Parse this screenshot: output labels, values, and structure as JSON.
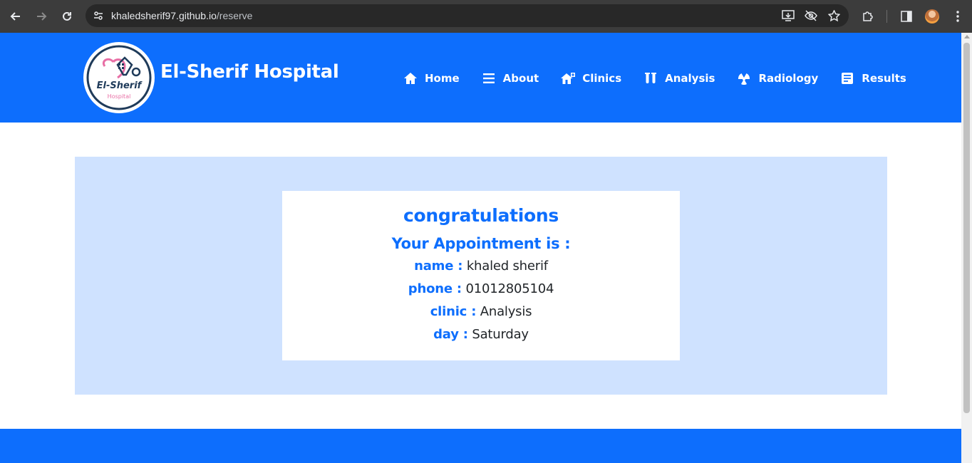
{
  "browser": {
    "url_host": "khaledsherif97.github.io",
    "url_path": "/reserve"
  },
  "header": {
    "brand": "El-Sherif Hospital",
    "logo": {
      "title": "El-Sherif",
      "subtitle": "Hospital"
    },
    "nav": [
      {
        "label": "Home",
        "icon": "home-icon"
      },
      {
        "label": "About",
        "icon": "bars-icon"
      },
      {
        "label": "Clinics",
        "icon": "clinic-icon"
      },
      {
        "label": "Analysis",
        "icon": "test-tubes-icon"
      },
      {
        "label": "Radiology",
        "icon": "radiation-icon"
      },
      {
        "label": "Results",
        "icon": "file-icon"
      }
    ]
  },
  "appointment": {
    "heading": "congratulations",
    "subheading": "Your Appointment is :",
    "fields": [
      {
        "label": "name :",
        "value": "khaled sherif"
      },
      {
        "label": "phone :",
        "value": "01012805104"
      },
      {
        "label": "clinic :",
        "value": "Analysis"
      },
      {
        "label": "day :",
        "value": "Saturday"
      }
    ]
  },
  "colors": {
    "primary": "#0d6efd",
    "panel": "#cfe2ff",
    "chrome": "#3c3c3c",
    "text": "#212529"
  }
}
